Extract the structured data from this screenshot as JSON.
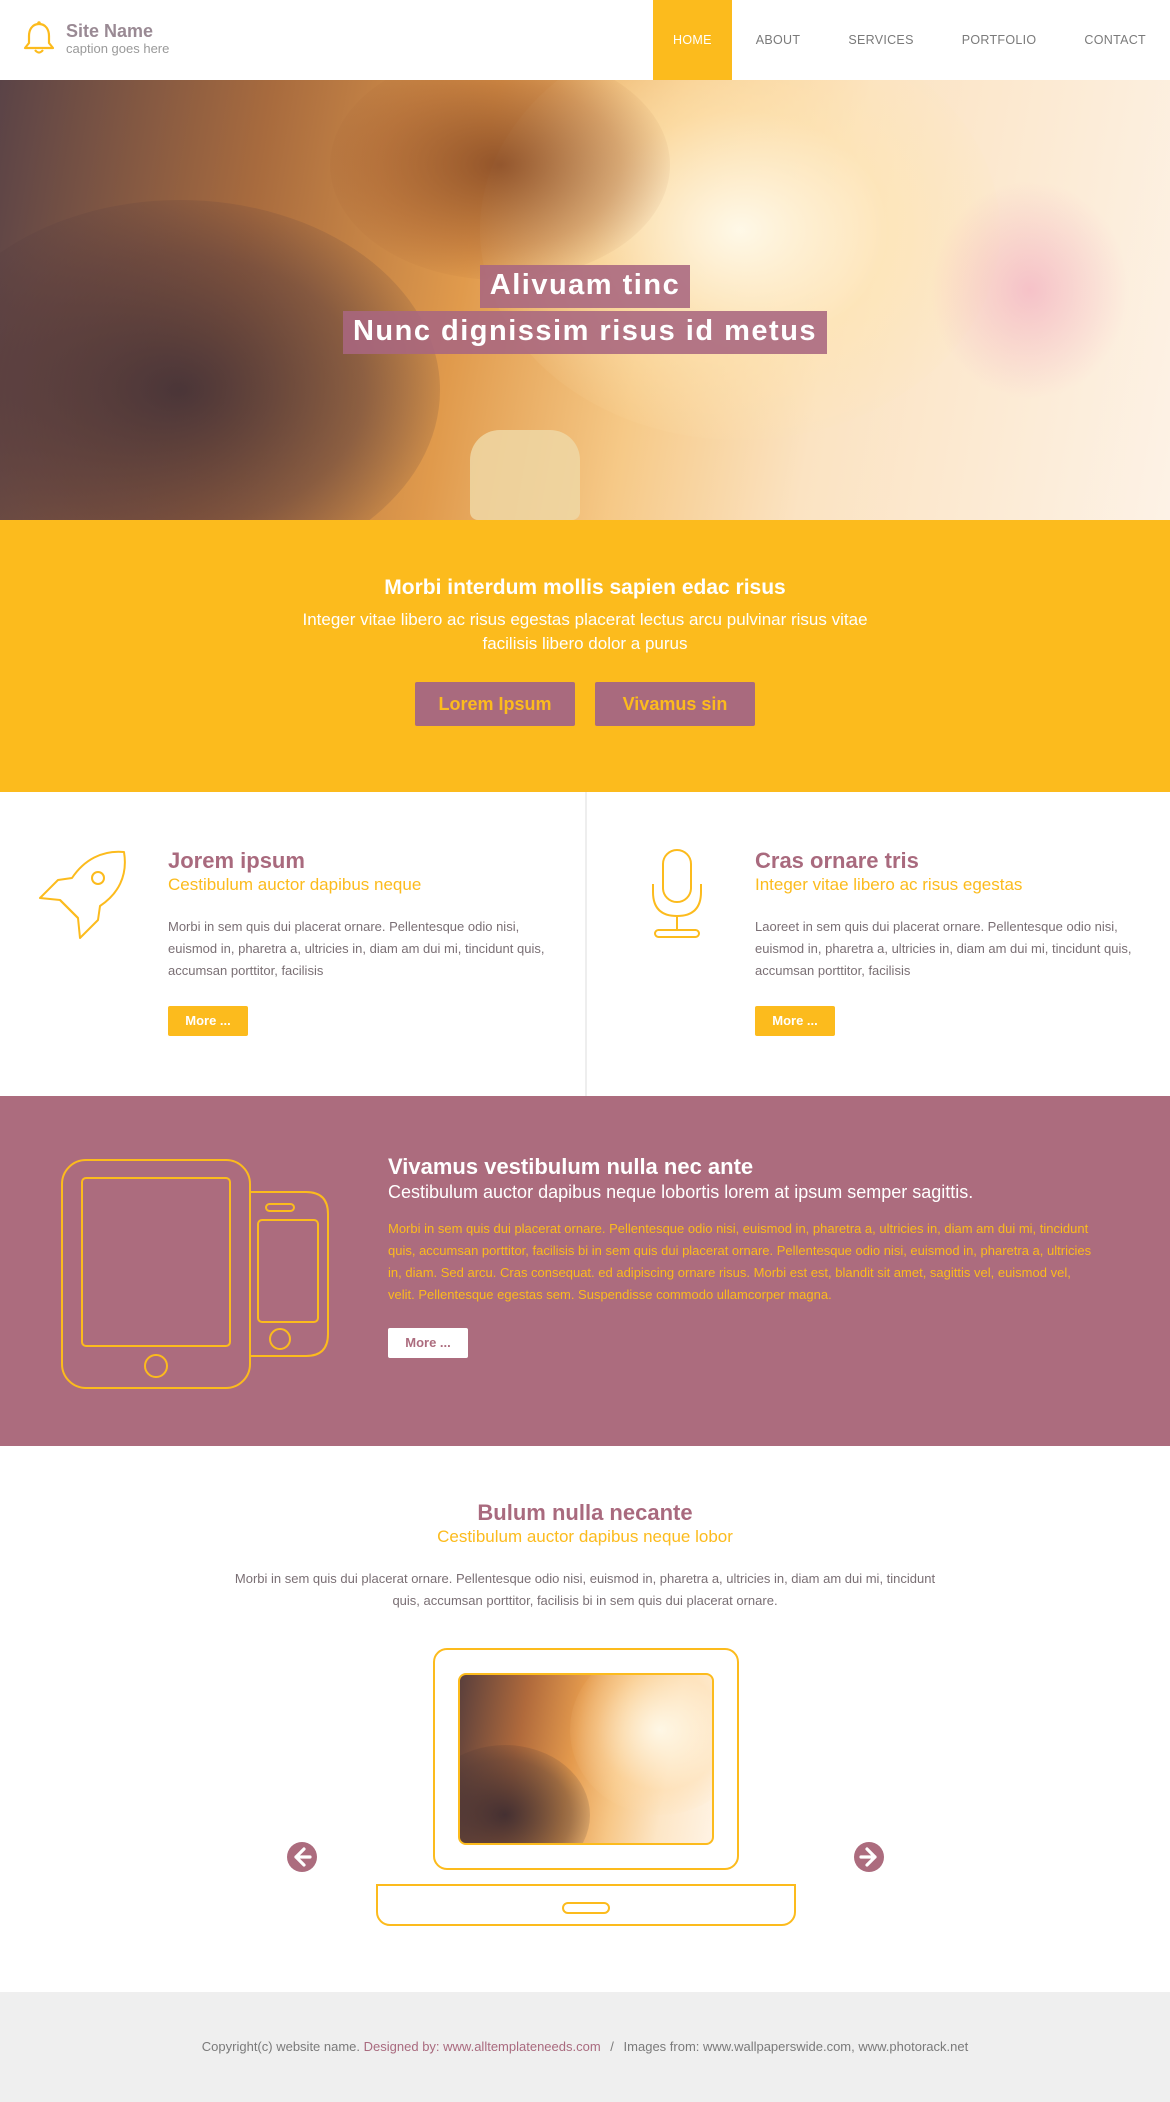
{
  "header": {
    "site_name": "Site Name",
    "caption": "caption goes here",
    "logo_icon": "bell-icon",
    "nav": [
      {
        "label": "HOME",
        "active": true
      },
      {
        "label": "ABOUT",
        "active": false
      },
      {
        "label": "SERVICES",
        "active": false
      },
      {
        "label": "PORTFOLIO",
        "active": false
      },
      {
        "label": "CONTACT",
        "active": false
      }
    ]
  },
  "hero": {
    "title_1": "Alivuam tinc",
    "title_2": "Nunc dignissim risus id metus"
  },
  "cta": {
    "heading": "Morbi interdum mollis sapien edac risus",
    "text": "Integer vitae libero ac risus egestas placerat lectus arcu pulvinar risus vitae facilisis libero dolor a purus",
    "button_1": "Lorem Ipsum",
    "button_2": "Vivamus sin"
  },
  "features": [
    {
      "icon": "rocket-icon",
      "title": "Jorem ipsum",
      "subtitle": "Cestibulum auctor dapibus neque",
      "text": "Morbi in sem quis dui placerat ornare. Pellentesque odio nisi, euismod in, pharetra a, ultricies in, diam am dui mi, tincidunt quis, accumsan porttitor, facilisis",
      "button": "More ..."
    },
    {
      "icon": "microphone-icon",
      "title": "Cras ornare tris",
      "subtitle": "Integer vitae libero ac risus egestas",
      "text": "Laoreet in sem quis dui placerat ornare. Pellentesque odio nisi, euismod in, pharetra a, ultricies in, diam am dui mi, tincidunt quis, accumsan porttitor, facilisis",
      "button": "More ..."
    }
  ],
  "devices": {
    "icon": "tablet-phone-icon",
    "title": "Vivamus vestibulum nulla nec ante",
    "subtitle": "Cestibulum auctor dapibus neque lobortis lorem at ipsum semper sagittis.",
    "text": "Morbi in sem quis dui placerat ornare. Pellentesque odio nisi, euismod in, pharetra a, ultricies in, diam am dui mi, tincidunt quis, accumsan porttitor, facilisis bi in sem quis dui placerat ornare. Pellentesque odio nisi, euismod in, pharetra a, ultricies in, diam. Sed arcu. Cras consequat. ed adipiscing ornare risus. Morbi est est, blandit sit amet, sagittis vel, euismod vel, velit. Pellentesque egestas sem. Suspendisse commodo ullamcorper magna.",
    "button": "More ..."
  },
  "showcase": {
    "title": "Bulum nulla necante",
    "subtitle": "Cestibulum auctor dapibus neque lobor",
    "text": "Morbi in sem quis dui placerat ornare. Pellentesque odio nisi, euismod in, pharetra a, ultricies in, diam am dui mi, tincidunt quis, accumsan porttitor, facilisis bi in sem quis dui placerat ornare.",
    "prev_icon": "arrow-left-circle-icon",
    "next_icon": "arrow-right-circle-icon"
  },
  "footer": {
    "copyright": "Copyright(c) website name.",
    "designed_by": "Designed by: www.alltemplateneeds.com",
    "separator": "/",
    "images_from": "Images from: www.wallpaperswide.com, www.photorack.net"
  },
  "colors": {
    "yellow": "#fcbb1d",
    "plum": "#ac6c7e",
    "footer_bg": "#efefef"
  }
}
